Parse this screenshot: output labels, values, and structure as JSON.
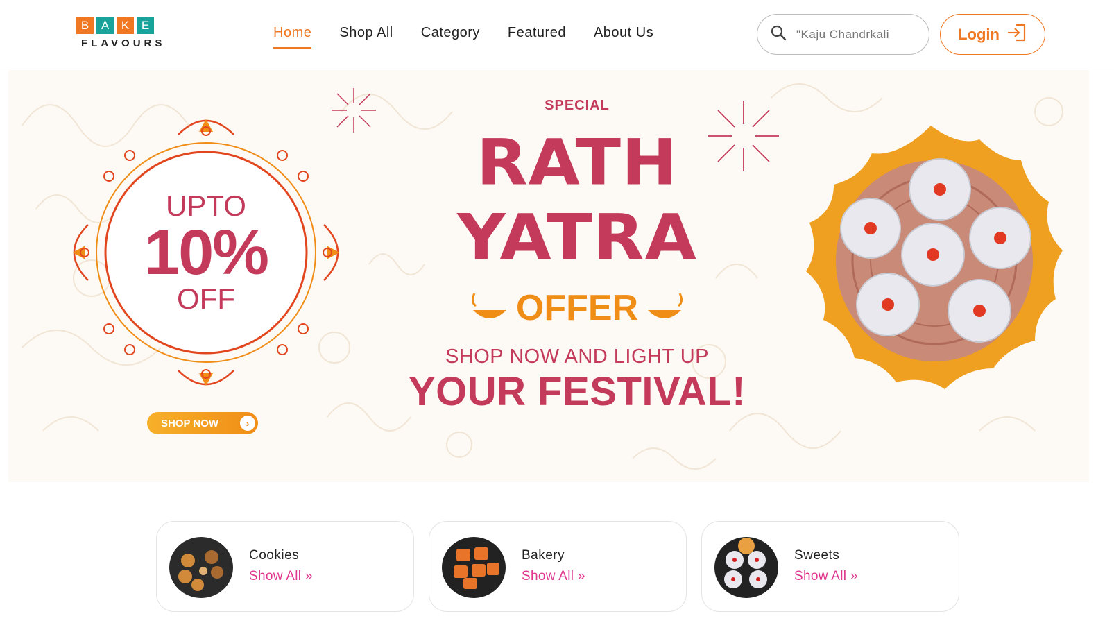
{
  "logo": {
    "letters": [
      "B",
      "A",
      "K",
      "E"
    ],
    "tile_colors": [
      "#f07822",
      "#1aa39a",
      "#f07822",
      "#1aa39a"
    ],
    "subtitle": "FLAVOURS"
  },
  "nav": {
    "items": [
      {
        "label": "Home",
        "active": true
      },
      {
        "label": "Shop All",
        "active": false
      },
      {
        "label": "Category",
        "active": false
      },
      {
        "label": "Featured",
        "active": false
      },
      {
        "label": "About Us",
        "active": false
      }
    ]
  },
  "search": {
    "placeholder": "\"Kaju Chandrkali"
  },
  "login": {
    "label": "Login"
  },
  "banner": {
    "offer_upto": "UPTO",
    "offer_percent": "10%",
    "offer_off": "OFF",
    "shop_now": "SHOP NOW",
    "special": "SPECIAL",
    "title_line1": "RATH",
    "title_line2": "YATRA",
    "offer": "OFFER",
    "tagline1": "SHOP NOW AND LIGHT UP",
    "tagline2": "YOUR FESTIVAL!"
  },
  "categories": [
    {
      "title": "Cookies",
      "link": "Show All »"
    },
    {
      "title": "Bakery",
      "link": "Show All »"
    },
    {
      "title": "Sweets",
      "link": "Show All »"
    }
  ],
  "colors": {
    "accent": "#f07822",
    "teal": "#1aa39a",
    "banner_red": "#c33a5b",
    "link_pink": "#e0368f",
    "marigold": "#f0a020"
  }
}
